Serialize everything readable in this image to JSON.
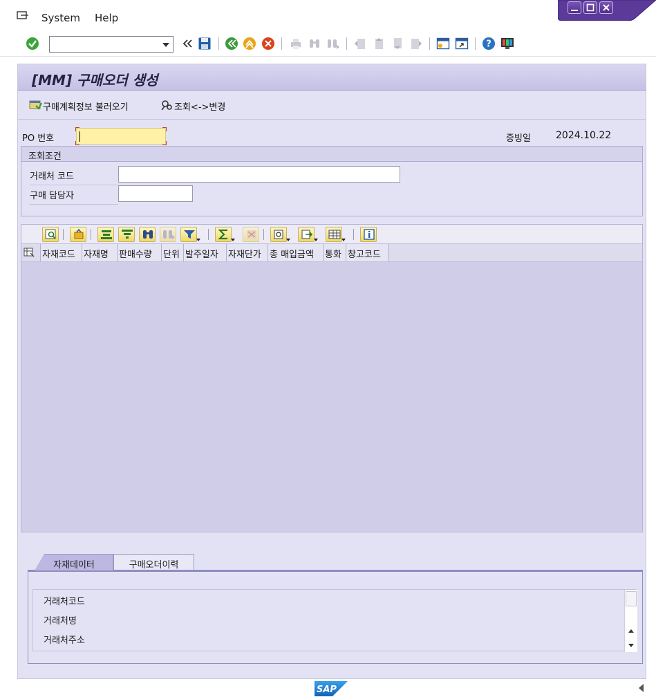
{
  "menu": {
    "system": "System",
    "help": "Help"
  },
  "toolbar": {
    "command_value": ""
  },
  "screen": {
    "title": "[MM] 구매오더 생성"
  },
  "appbar": {
    "load_plan": "구매계획정보 불러오기",
    "toggle_mode": "조회<->변경"
  },
  "header": {
    "po_label": "PO 번호",
    "po_value": "",
    "doc_date_label": "증빙일",
    "doc_date_value": "2024.10.22"
  },
  "search": {
    "title": "조회조건",
    "vendor_label": "거래처 코드",
    "vendor_value": "",
    "buyer_label": "구매 담당자",
    "buyer_value": ""
  },
  "grid": {
    "columns": [
      "자재코드",
      "자재명",
      "판매수량",
      "단위",
      "발주일자",
      "자재단가",
      "총 매입금액",
      "통화",
      "창고코드"
    ]
  },
  "tabs": {
    "items": [
      "자재데이터",
      "구매오더이력"
    ],
    "active": 0,
    "rows": [
      "거래처코드",
      "거래처명",
      "거래처주소"
    ]
  },
  "footer": {
    "logo": "SAP"
  },
  "colors": {
    "panel": "#e3e2f4",
    "title_band": "#c5c1e6",
    "required_field": "#fff2a6",
    "grid_body": "#cfcde8",
    "window_controls": "#5b3a9a"
  }
}
